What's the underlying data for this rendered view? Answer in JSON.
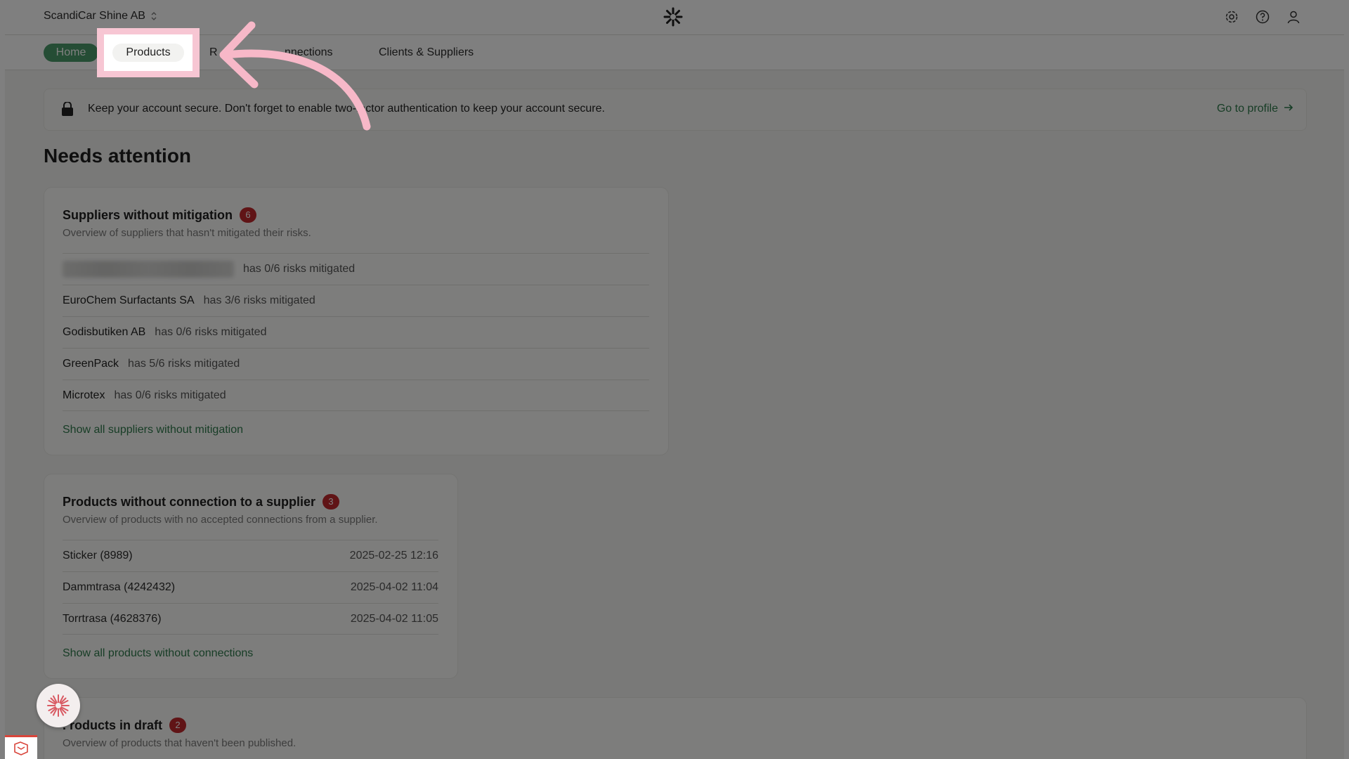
{
  "topbar": {
    "org_name": "ScandiCar Shine AB",
    "icons": [
      "gear-icon",
      "help-icon",
      "user-icon"
    ]
  },
  "nav": {
    "home": "Home",
    "products": "Products",
    "r_partial": "R",
    "connections_partial": "nnections",
    "clients": "Clients & Suppliers"
  },
  "banner": {
    "message": "Keep your account secure. Don't forget to enable two-factor authentication to keep your account secure.",
    "link": "Go to profile"
  },
  "section_title": "Needs attention",
  "suppliers_card": {
    "title": "Suppliers without mitigation",
    "count": "6",
    "subtitle": "Overview of suppliers that hasn't mitigated their risks.",
    "rows": [
      {
        "name": "",
        "status": "has 0/6 risks mitigated"
      },
      {
        "name": "EuroChem Surfactants SA",
        "status": "has 3/6 risks mitigated"
      },
      {
        "name": "Godisbutiken AB",
        "status": "has 0/6 risks mitigated"
      },
      {
        "name": "GreenPack",
        "status": "has 5/6 risks mitigated"
      },
      {
        "name": "Microtex",
        "status": "has 0/6 risks mitigated"
      }
    ],
    "more": "Show all suppliers without mitigation"
  },
  "products_card": {
    "title": "Products without connection to a supplier",
    "count": "3",
    "subtitle": "Overview of products with no accepted connections from a supplier.",
    "rows": [
      {
        "name": "Sticker (8989)",
        "date": "2025-02-25 12:16"
      },
      {
        "name": "Dammtrasa (4242432)",
        "date": "2025-04-02 11:04"
      },
      {
        "name": "Torrtrasa (4628376)",
        "date": "2025-04-02 11:05"
      }
    ],
    "more": "Show all products without connections"
  },
  "draft_card": {
    "title_partial": ". roducts in draft",
    "count": "2",
    "subtitle": "Overview of products that haven't been published."
  },
  "colors": {
    "accent_green": "#4a9b6a",
    "link_green": "#2f7a4c",
    "badge_red": "#c0282d",
    "highlight_pink": "#f7c6d3"
  }
}
